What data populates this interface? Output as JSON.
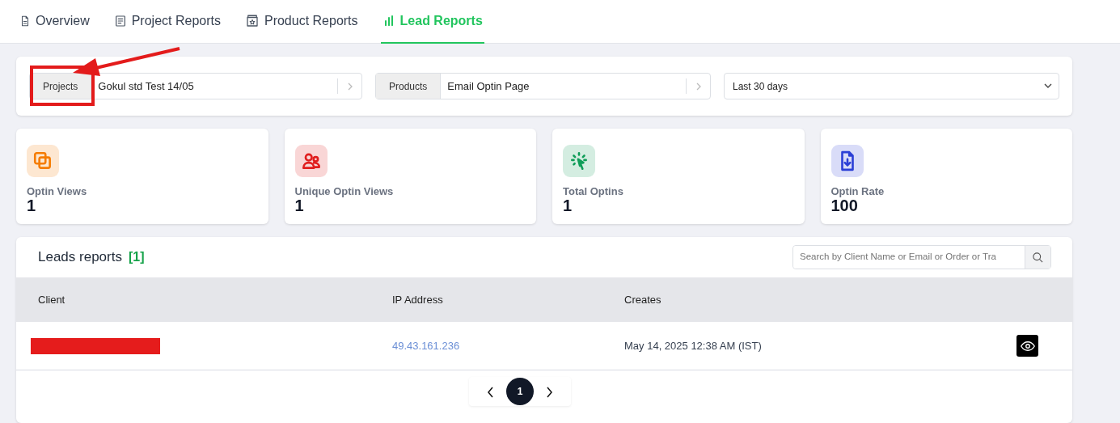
{
  "tabs": [
    {
      "label": "Overview",
      "selected": false
    },
    {
      "label": "Project Reports",
      "selected": false
    },
    {
      "label": "Product Reports",
      "selected": false
    },
    {
      "label": "Lead Reports",
      "selected": true
    }
  ],
  "filters": {
    "project": {
      "label": "Projects",
      "value": "Gokul std Test 14/05"
    },
    "product": {
      "label": "Products",
      "value": "Email Optin Page"
    },
    "period": {
      "value": "Last 30 days"
    }
  },
  "stats": [
    {
      "label": "Optin Views",
      "value": "1",
      "color": "#f57c00"
    },
    {
      "label": "Unique Optin Views",
      "value": "1",
      "color": "#e01e1e"
    },
    {
      "label": "Total Optins",
      "value": "1",
      "color": "#0f9d58"
    },
    {
      "label": "Optin Rate",
      "value": "100",
      "color": "#2b3fd6"
    }
  ],
  "leads": {
    "title": "Leads reports",
    "count": "[1]",
    "search": {
      "placeholder": "Search by Client Name or Email or Order or Tra"
    },
    "columns": [
      "Client",
      "IP Address",
      "Creates"
    ],
    "rows": [
      {
        "client_redacted": true,
        "ip": "49.43.161.236",
        "created": "May 14, 2025 12:38 AM (IST)"
      }
    ],
    "pages": [
      {
        "label": "1",
        "selected": true
      }
    ]
  },
  "annotation": {
    "highlight": true,
    "arrow": true
  }
}
